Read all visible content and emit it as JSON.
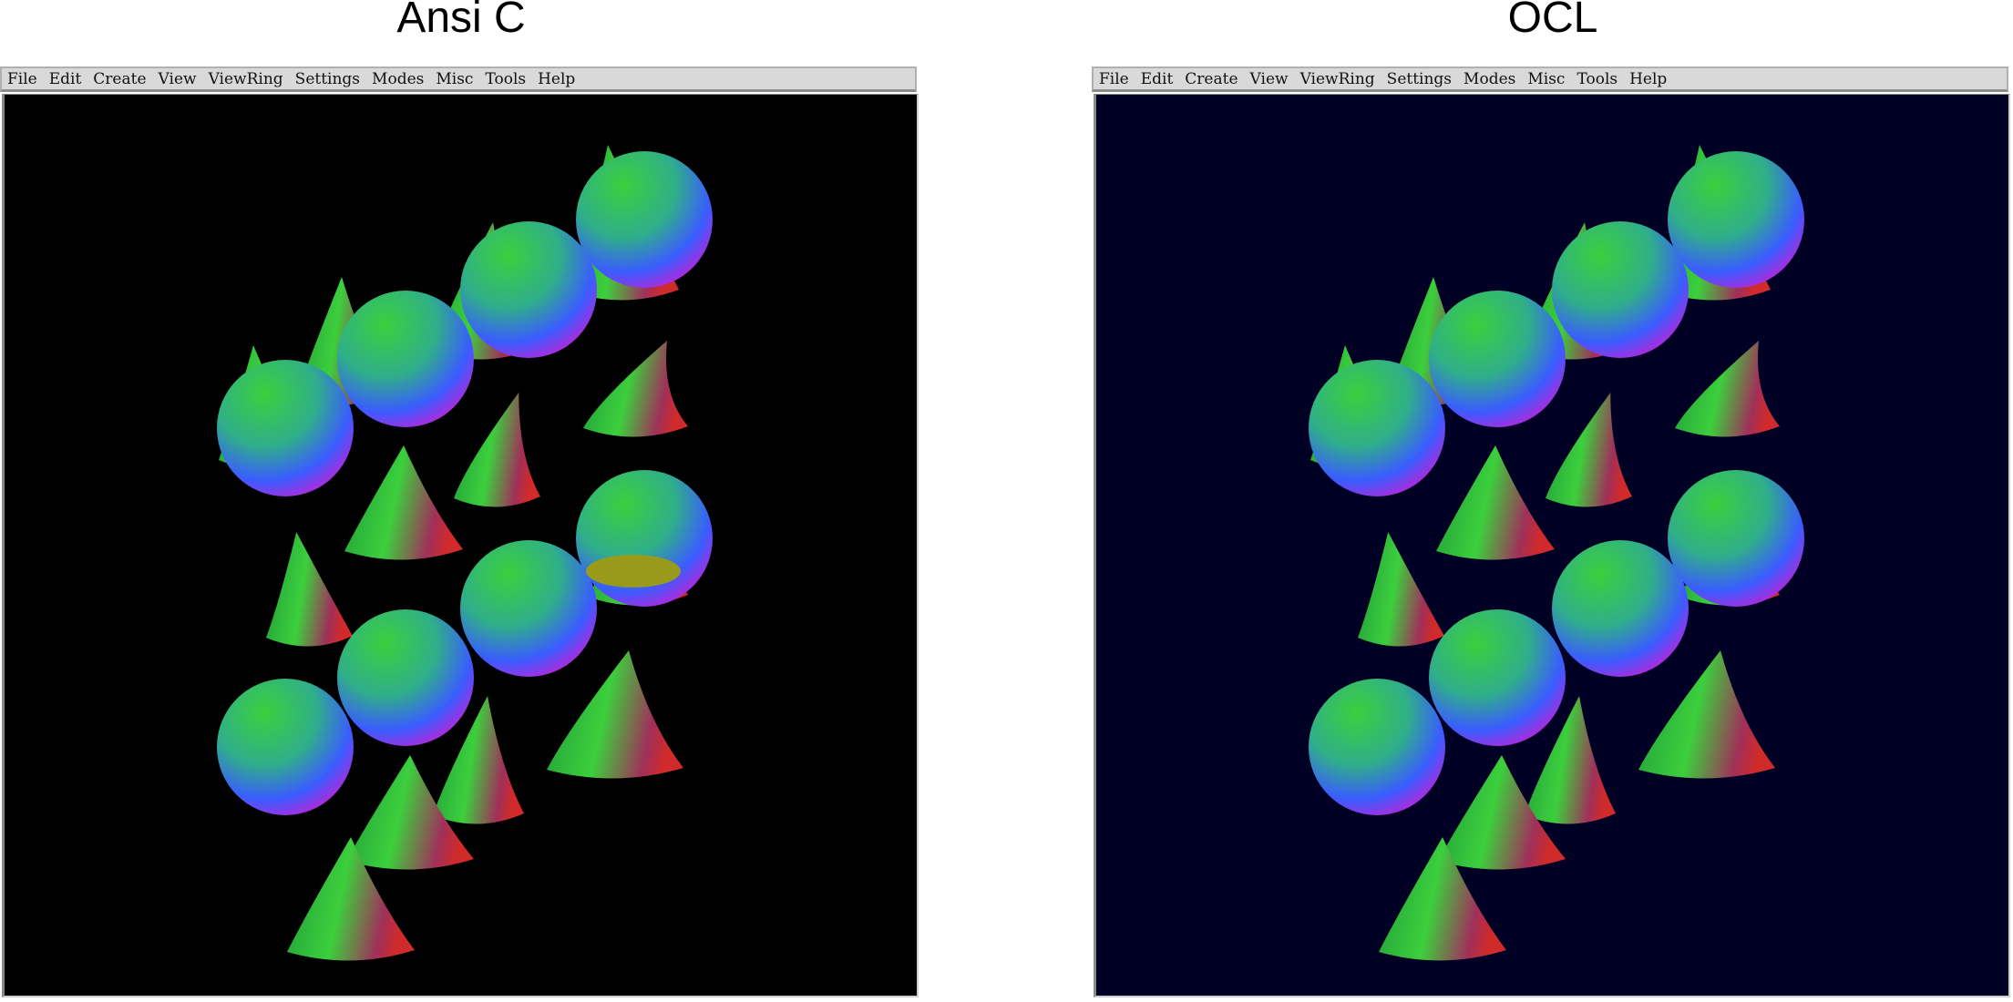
{
  "panels": [
    {
      "title": "Ansi C",
      "background": "#000000",
      "menu": [
        {
          "label": "File"
        },
        {
          "label": "Edit"
        },
        {
          "label": "Create"
        },
        {
          "label": "View"
        },
        {
          "label": "ViewRing"
        },
        {
          "label": "Settings"
        },
        {
          "label": "Modes"
        },
        {
          "label": "Misc"
        },
        {
          "label": "Tools"
        },
        {
          "label": "Help"
        }
      ]
    },
    {
      "title": "OCL",
      "background": "#000024",
      "menu": [
        {
          "label": "File"
        },
        {
          "label": "Edit"
        },
        {
          "label": "Create"
        },
        {
          "label": "View"
        },
        {
          "label": "ViewRing"
        },
        {
          "label": "Settings"
        },
        {
          "label": "Modes"
        },
        {
          "label": "Misc"
        },
        {
          "label": "Tools"
        },
        {
          "label": "Help"
        }
      ]
    }
  ],
  "scene": {
    "objects": [
      "sphere",
      "cone"
    ],
    "colors": {
      "green": "#3ccf3c",
      "blue": "#3a5cff",
      "magenta": "#d21ad2",
      "red": "#d02a2a",
      "olive": "#9a9a1a"
    }
  }
}
